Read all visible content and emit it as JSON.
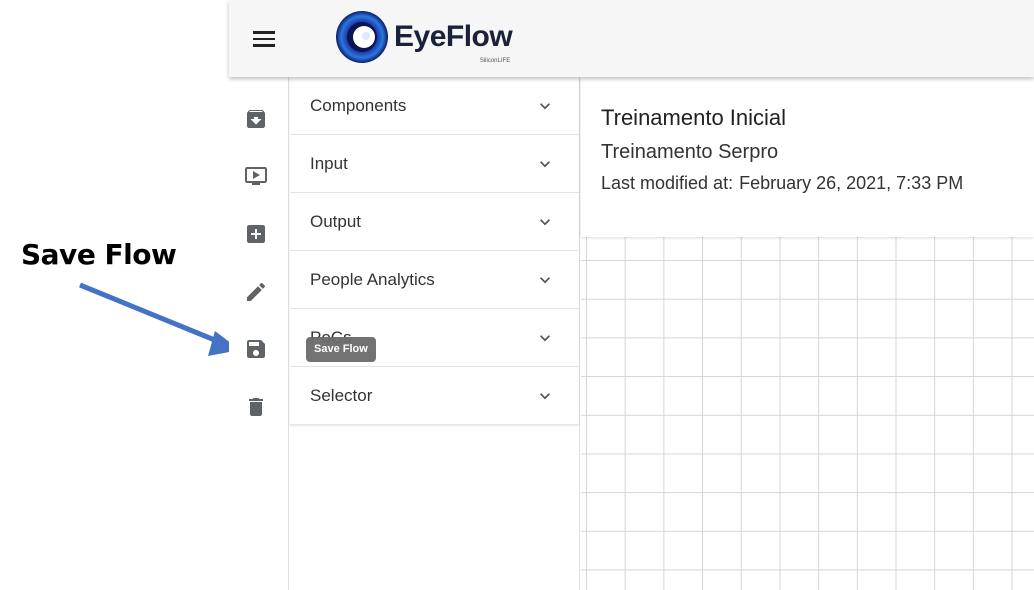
{
  "annotation": {
    "label": "Save Flow"
  },
  "header": {
    "brand": "EyeFlow",
    "brand_sub": "SiliconLIFE"
  },
  "rail": {
    "items": [
      {
        "icon": "archive-download-icon",
        "name": "import"
      },
      {
        "icon": "play-screen-icon",
        "name": "run"
      },
      {
        "icon": "add-box-icon",
        "name": "add"
      },
      {
        "icon": "pencil-icon",
        "name": "edit"
      },
      {
        "icon": "save-floppy-icon",
        "name": "save"
      },
      {
        "icon": "trash-icon",
        "name": "delete"
      }
    ]
  },
  "panel": {
    "sections": [
      {
        "label": "Components"
      },
      {
        "label": "Input"
      },
      {
        "label": "Output"
      },
      {
        "label": "People Analytics"
      },
      {
        "label": "PoCs"
      },
      {
        "label": "Selector"
      }
    ]
  },
  "tooltip": {
    "text": "Save Flow"
  },
  "flow": {
    "title": "Treinamento Inicial",
    "subtitle": "Treinamento Serpro",
    "modified_label": "Last modified at:",
    "modified_value": "February 26, 2021, 7:33 PM"
  },
  "colors": {
    "accent_arrow": "#4472c4",
    "logo_blue": "#1f3fae",
    "icon_gray": "#5f6368"
  }
}
